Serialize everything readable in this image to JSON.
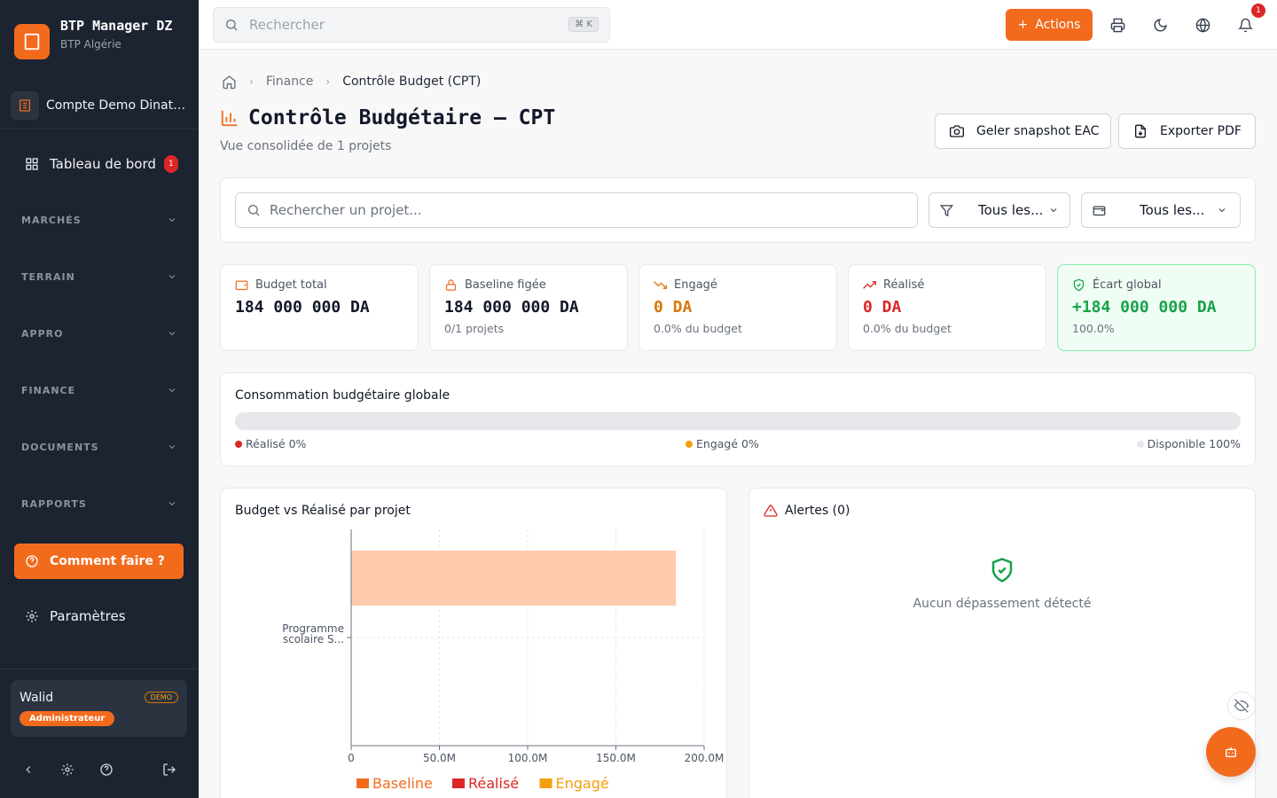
{
  "brand": {
    "name": "BTP Manager DZ",
    "subtitle": "BTP Algérie"
  },
  "account": {
    "name": "Compte Demo Dinatec Sarl"
  },
  "sidebar": {
    "dashboard": {
      "label": "Tableau de bord",
      "badge": "1"
    },
    "sections": [
      "MARCHÉS",
      "TERRAIN",
      "APPRO",
      "FINANCE",
      "DOCUMENTS",
      "RAPPORTS"
    ],
    "help_label": "Comment faire ?",
    "settings_label": "Paramètres",
    "user": {
      "name": "Walid",
      "demo": "DEMO",
      "role": "Administrateur"
    }
  },
  "topbar": {
    "search_placeholder": "Rechercher",
    "shortcut": "⌘ K",
    "actions_label": "Actions",
    "notif_count": "1"
  },
  "breadcrumb": {
    "level1": "Finance",
    "current": "Contrôle Budget (CPT)"
  },
  "page": {
    "title": "Contrôle Budgétaire — CPT",
    "subtitle": "Vue consolidée de 1 projets",
    "freeze_label": "Geler snapshot EAC",
    "export_label": "Exporter PDF"
  },
  "filters": {
    "search_placeholder": "Rechercher un projet...",
    "select1": "Tous les...",
    "select2": "Tous les..."
  },
  "kpis": [
    {
      "label": "Budget total",
      "value": "184 000 000  DA",
      "sub": "",
      "color": "#111827"
    },
    {
      "label": "Baseline figée",
      "value": "184 000 000  DA",
      "sub": "0/1 projets",
      "color": "#111827"
    },
    {
      "label": "Engagé",
      "value": "0  DA",
      "sub": "0.0% du budget",
      "color": "#d97706"
    },
    {
      "label": "Réalisé",
      "value": "0  DA",
      "sub": "0.0% du budget",
      "color": "#dc2626"
    },
    {
      "label": "Écart global",
      "value": "+184 000 000  DA",
      "sub": "100.0%",
      "color": "#16a34a"
    }
  ],
  "consumption": {
    "title": "Consommation budgétaire globale",
    "realise_pct": 0,
    "realise_label": "Réalisé 0%",
    "engage_label": "Engagé 0%",
    "disponible_label": "Disponible 100%"
  },
  "chart_panel": {
    "title": "Budget vs Réalisé par projet"
  },
  "chart_data": {
    "type": "bar",
    "orientation": "horizontal",
    "categories": [
      "Programme scolaire S..."
    ],
    "category_lines": [
      [
        "Programme",
        "scolaire S..."
      ]
    ],
    "series": [
      {
        "name": "Baseline",
        "values": [
          184000000
        ],
        "color": "#fdcbab"
      },
      {
        "name": "Réalisé",
        "values": [
          0
        ],
        "color": "#dc2626"
      },
      {
        "name": "Engagé",
        "values": [
          0
        ],
        "color": "#f59e0b"
      }
    ],
    "xlim": [
      0,
      200000000
    ],
    "x_ticks": [
      0,
      50000000,
      100000000,
      150000000,
      200000000
    ],
    "x_tick_labels": [
      "0",
      "50.0M",
      "100.0M",
      "150.0M",
      "200.0M"
    ],
    "grid": true,
    "legend": "bottom",
    "legend_colors": [
      "#f26b1d",
      "#dc2626",
      "#f59e0b"
    ]
  },
  "alerts": {
    "title": "Alertes (0)",
    "empty_text": "Aucun dépassement détecté"
  }
}
